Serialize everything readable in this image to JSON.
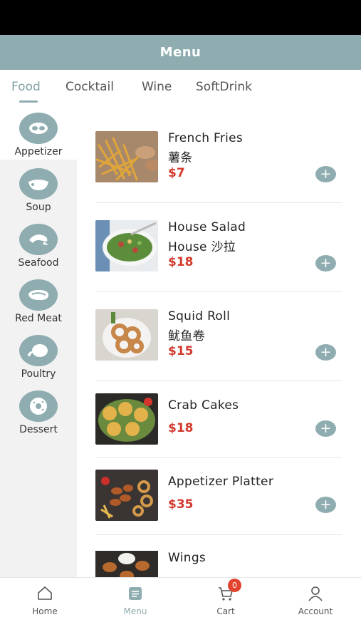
{
  "header": {
    "title": "Menu"
  },
  "tabs": [
    {
      "label": "Food",
      "active": true
    },
    {
      "label": "Cocktail",
      "active": false
    },
    {
      "label": "Wine",
      "active": false
    },
    {
      "label": "SoftDrink",
      "active": false
    }
  ],
  "categories": [
    {
      "label": "Appetizer",
      "icon": "sushi-roll-icon",
      "active": true
    },
    {
      "label": "Soup",
      "icon": "soup-bowl-icon",
      "active": false
    },
    {
      "label": "Seafood",
      "icon": "shrimp-icon",
      "active": false
    },
    {
      "label": "Red Meat",
      "icon": "steak-icon",
      "active": false
    },
    {
      "label": "Poultry",
      "icon": "chicken-icon",
      "active": false
    },
    {
      "label": "Dessert",
      "icon": "donut-icon",
      "active": false
    }
  ],
  "items": [
    {
      "name": "French Fries",
      "subname": "薯条",
      "price": "$7",
      "image": "french-fries-photo"
    },
    {
      "name": "House Salad",
      "subname": "House 沙拉",
      "price": "$18",
      "image": "house-salad-photo"
    },
    {
      "name": "Squid Roll",
      "subname": "鱿鱼卷",
      "price": "$15",
      "image": "squid-roll-photo"
    },
    {
      "name": "Crab Cakes",
      "subname": "",
      "price": "$18",
      "image": "crab-cakes-photo"
    },
    {
      "name": "Appetizer Platter",
      "subname": "",
      "price": "$35",
      "image": "appetizer-platter-photo"
    },
    {
      "name": "Wings",
      "subname": "",
      "price": "",
      "image": "wings-photo"
    }
  ],
  "add_label": "+",
  "nav": [
    {
      "label": "Home",
      "icon": "home-icon",
      "active": false
    },
    {
      "label": "Menu",
      "icon": "menu-icon",
      "active": true
    },
    {
      "label": "Cart",
      "icon": "cart-icon",
      "active": false,
      "badge": "0"
    },
    {
      "label": "Account",
      "icon": "user-icon",
      "active": false
    }
  ],
  "colors": {
    "accent": "#8fadb0",
    "price": "#d23a2e",
    "badge": "#e2432f"
  }
}
